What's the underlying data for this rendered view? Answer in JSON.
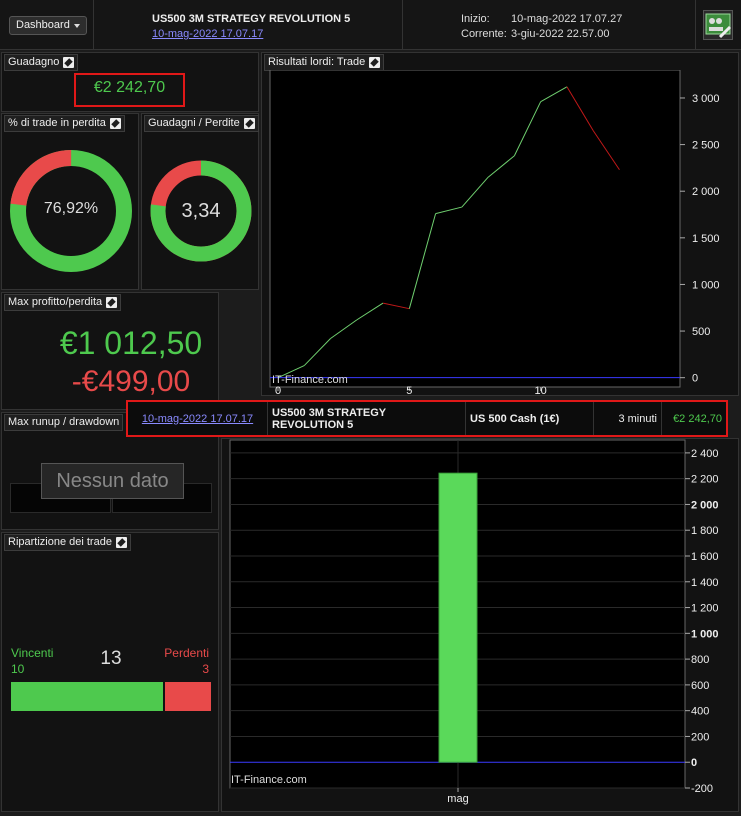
{
  "header": {
    "dashboard_label": "Dashboard",
    "strategy_title": "US500 3M STRATEGY REVOLUTION 5",
    "strategy_date": "10-mag-2022 17.07.17",
    "start_label": "Inizio:",
    "start_value": "10-mag-2022 17.07.27",
    "current_label": "Corrente:",
    "current_value": "3-giu-2022 22.57.00",
    "tool_icon": "strategy-tools-icon"
  },
  "gain": {
    "title": "Guadagno",
    "value": "€2 242,70"
  },
  "losing_pct": {
    "title": "% di trade in perdita",
    "value": "76,92%",
    "fraction": 0.7692
  },
  "gain_loss_ratio": {
    "title": "Guadagni / Perdite",
    "value": "3,34",
    "fraction": 0.77
  },
  "max_profit_loss": {
    "title": "Max profitto/perdita",
    "profit": "€1 012,50",
    "loss": "-€499,00"
  },
  "runup": {
    "title": "Max runup / drawdown",
    "no_data": "Nessun dato"
  },
  "breakdown": {
    "title": "Ripartizione dei trade",
    "winners_label": "Vincenti",
    "winners_value": "10",
    "total": "13",
    "losers_label": "Perdenti",
    "losers_value": "3",
    "winners_count": 10,
    "losers_count": 3
  },
  "results_chart_title": "Risultati lordi: Trade",
  "watermark": "IT-Finance.com",
  "trade_row": {
    "date": "10-mag-2022 17.07.17",
    "strategy": "US500 3M STRATEGY REVOLUTION 5",
    "instrument": "US 500 Cash (1€)",
    "duration": "3 minuti",
    "gain": "€2 242,70"
  },
  "colors": {
    "green": "#4ec94e",
    "red": "#e84a4a",
    "zero_line": "#3a3aff",
    "bar_green": "#5ad95a"
  },
  "chart_data": [
    {
      "type": "line",
      "x": [
        0,
        1,
        2,
        3,
        4,
        5,
        6,
        7,
        8,
        9,
        10,
        11,
        12,
        13
      ],
      "y": [
        0,
        130,
        420,
        620,
        800,
        740,
        1760,
        1830,
        2150,
        2380,
        2960,
        3120,
        2650,
        2230
      ],
      "xticks": [
        "0",
        "5",
        "10"
      ],
      "ylim": [
        -100,
        3300
      ],
      "yticks": [
        "0",
        "500",
        "1 000",
        "1 500",
        "2 000",
        "2 500",
        "3 000"
      ]
    },
    {
      "type": "bar",
      "categories": [
        "mag"
      ],
      "values": [
        2242.7
      ],
      "ylim": [
        -200,
        2500
      ],
      "yticks": [
        "-200",
        "0",
        "200",
        "400",
        "600",
        "800",
        "1 000",
        "1 200",
        "1 400",
        "1 600",
        "1 800",
        "2 000",
        "2 200",
        "2 400"
      ]
    }
  ]
}
